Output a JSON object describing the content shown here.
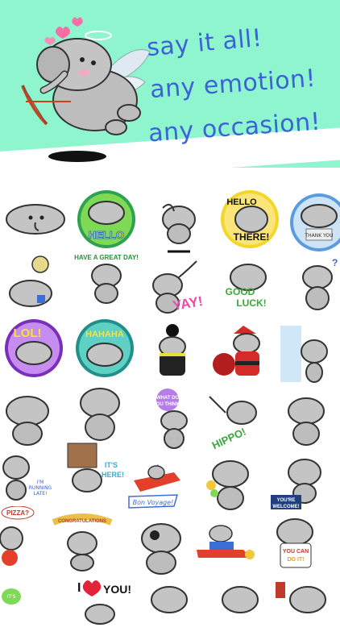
{
  "hero": {
    "taglines": [
      "say it all!",
      "any emotion!",
      "any occasion!"
    ],
    "background_color": "#8ef5cf",
    "text_color": "#3d62d8",
    "icon": "cupid-elephant-icon"
  },
  "stickers": {
    "hello": "HELLO",
    "hello_there_line1": "HELLO",
    "hello_there_line2": "THERE!",
    "thank_you": "THANK YOU",
    "have_a_great_day": "HAVE A GREAT DAY!",
    "yay": "YAY!",
    "good_luck_line1": "GOOD",
    "good_luck_line2": "LUCK!",
    "lol": "LOL!",
    "hahaha": "HAHAHA",
    "what_do_you_think_line1": "WHAT DO",
    "what_do_you_think_line2": "YOU THINK?",
    "hippo": "HIPPO!",
    "running_late_line1": "I'M",
    "running_late_line2": "RUNNING",
    "running_late_line3": "LATE!",
    "its_here_line1": "IT'S",
    "its_here_line2": "HERE!",
    "bon_voyage": "Bon Voyage!",
    "youre_welcome_line1": "YOU'RE",
    "youre_welcome_line2": "WELCOME!",
    "pizza": "PIZZA?",
    "congratulations": "CONGRATULATIONS",
    "you_can_do_it_line1": "YOU CAN",
    "you_can_do_it_line2": "DO IT!",
    "i_love_you_prefix": "I",
    "i_love_you_suffix": "YOU!"
  }
}
